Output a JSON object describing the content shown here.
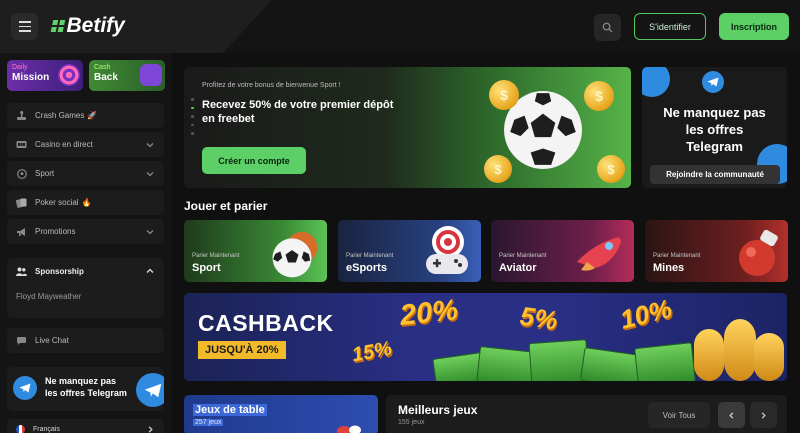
{
  "brand": {
    "name": "Betify",
    "accent": "#5cd067"
  },
  "header": {
    "login_label": "S'identifier",
    "register_label": "Inscription",
    "menu_icon": "hamburger-icon",
    "search_icon": "search-icon"
  },
  "sidebar": {
    "promos": [
      {
        "small": "Daily",
        "big": "Mission"
      },
      {
        "small": "Cash",
        "big": "Back"
      }
    ],
    "items": [
      {
        "label": "Crash Games",
        "emoji": "🚀",
        "icon": "joystick-icon"
      },
      {
        "label": "Casino en direct",
        "icon": "casino-icon"
      },
      {
        "label": "Sport",
        "icon": "ball-icon"
      },
      {
        "label": "Poker social",
        "emoji": "🔥",
        "icon": "cards-icon"
      },
      {
        "label": "Promotions",
        "icon": "megaphone-icon"
      }
    ],
    "sponsorship": {
      "label": "Sponsorship",
      "item": "Floyd Mayweather"
    },
    "live_chat": "Live Chat",
    "telegram": {
      "line1": "Ne manquez pas",
      "line2": "les offres Telegram"
    },
    "language": "Français"
  },
  "hero": {
    "subtitle": "Profitez de votre bonus de bienvenue Sport !",
    "title_line1": "Recevez 50% de votre premier dépôt",
    "title_line2": "en freebet",
    "cta": "Créer un compte",
    "coin_symbol": "$"
  },
  "telegram_card": {
    "line1": "Ne manquez pas",
    "line2": "les offres",
    "line3": "Telegram",
    "button": "Rejoindre la communauté"
  },
  "play": {
    "title": "Jouer et parier",
    "categories": [
      {
        "small": "Parier Maintenant",
        "name": "Sport"
      },
      {
        "small": "Parier Maintenant",
        "name": "eSports"
      },
      {
        "small": "Parier Maintenant",
        "name": "Aviator"
      },
      {
        "small": "Parier Maintenant",
        "name": "Mines"
      }
    ]
  },
  "cashback": {
    "title": "CASHBACK",
    "subtitle": "JUSQU'À 20%",
    "percents": [
      "20%",
      "5%",
      "10%",
      "15%"
    ]
  },
  "table_games": {
    "title": "Jeux de table",
    "count": "257 jeux"
  },
  "best_games": {
    "title": "Meilleurs jeux",
    "count": "155 jeux",
    "see_all": "Voir Tous"
  }
}
